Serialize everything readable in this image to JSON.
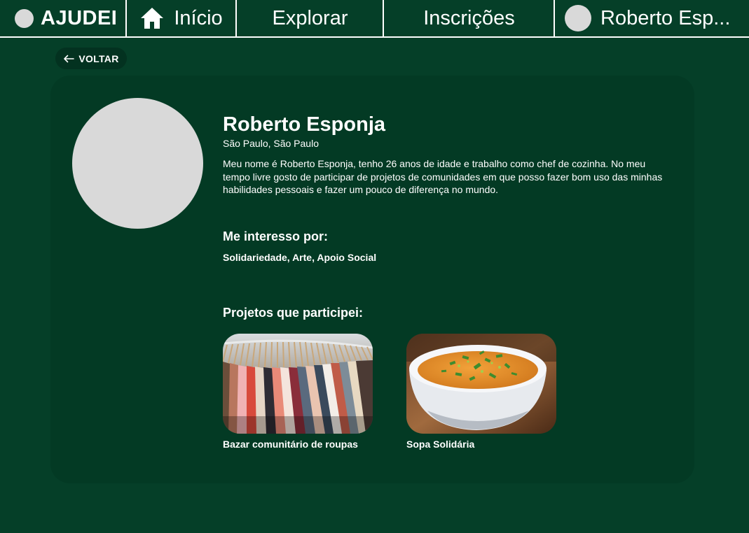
{
  "nav": {
    "brand": "AJUDEI",
    "home_label": "Início",
    "explore_label": "Explorar",
    "inscricoes_label": "Inscrições",
    "user_label": "Roberto Esp..."
  },
  "back_button": {
    "label": "VOLTAR"
  },
  "profile": {
    "name": "Roberto Esponja",
    "location": "São Paulo, São Paulo",
    "bio": "Meu nome é Roberto Esponja, tenho 26 anos de idade e trabalho como chef de cozinha. No meu tempo livre gosto de participar de projetos de comunidades em que posso fazer bom uso das minhas habilidades pessoais e fazer um pouco de diferença no mundo."
  },
  "interests": {
    "title": "Me interesso por:",
    "list": "Solidariedade, Arte, Apoio Social"
  },
  "projects": {
    "title": "Projetos que participei:",
    "items": [
      {
        "name": "Bazar comunitário de roupas",
        "image_icon": "clothing-rack-photo"
      },
      {
        "name": "Sopa Solidária",
        "image_icon": "soup-bowl-photo"
      }
    ]
  },
  "colors": {
    "background": "#053f28",
    "card": "#033a24",
    "back_button": "#033220",
    "avatar_placeholder": "#d9d9d9",
    "text": "#ffffff"
  }
}
